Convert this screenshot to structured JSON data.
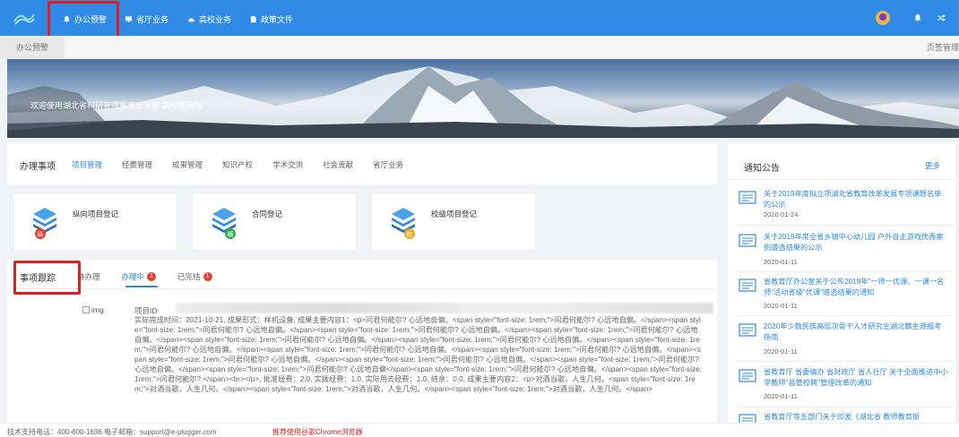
{
  "topbar": {
    "nav": [
      {
        "label": "办公预警",
        "icon": "bell-icon"
      },
      {
        "label": "省厅业务",
        "icon": "monitor-icon"
      },
      {
        "label": "高校业务",
        "icon": "cloud-icon"
      },
      {
        "label": "政策文件",
        "icon": "file-icon"
      }
    ],
    "accent": "#2f8be6",
    "highlight": "#e02020"
  },
  "breadcrumb": {
    "current": "办公预警",
    "right": "页签管理"
  },
  "banner": {
    "text": "欢迎使用湖北省科研管理服务云平台-高校通用版"
  },
  "tasks": {
    "title": "办理事项",
    "tabs": [
      "项目管理",
      "经费管理",
      "成果管理",
      "知识产权",
      "学术交流",
      "社会贡献",
      "省厅业务"
    ],
    "active_tab": "项目管理",
    "cards": [
      {
        "label": "纵向项目登记",
        "badge": "纵",
        "badge_color": "#e8402f"
      },
      {
        "label": "合同登记",
        "badge": "横",
        "badge_color": "#2eaa4a"
      },
      {
        "label": "校级项目登记",
        "badge": "校",
        "badge_color": "#f0a81f"
      }
    ]
  },
  "tracking": {
    "title": "事项跟踪",
    "tabs": [
      {
        "label": "待办理",
        "badge": ""
      },
      {
        "label": "办理中",
        "badge": "1"
      },
      {
        "label": "已完结",
        "badge": "1"
      }
    ],
    "active_tab": "办理中",
    "img_alt": "img",
    "item_id_label": "项目ID:",
    "detail": "实际完成时间：2021-10-21, 成果形式：样机设备, 成果主要内容1：<p>问君何能尔? 心远地自偏。<span style=\"font-size: 1rem;\">问君何能尔? 心远地自偏。</span><span style=\"font-size: 1rem;\">问君何能尔? 心远地自偏。</span><span style=\"font-size: 1rem;\">问君何能尔? 心远地自偏。</span><span style=\"font-size: 1rem;\">问君何能尔? 心远地自偏。</span><span style=\"font-size: 1rem;\">问君何能尔? 心远地自偏。</span><span style=\"font-size: 1rem;\">问君何能尔? 心远地自偏。</span><span style=\"font-size: 1rem;\">问君何能尔? 心远地自偏。</span><span style=\"font-size: 1rem;\">问君何能尔? 心远地自偏。</span><span style=\"font-size: 1rem;\">问君何能尔? 心远地自偏。</span><span style=\"font-size: 1rem;\">问君何能尔? 心远地自偏。</span><span style=\"font-size: 1rem;\">问君何能尔? 心远地自偏。</span><span style=\"font-size: 1rem;\">问君何能尔? 心远地自偏。</span><span style=\"font-size: 1rem;\">问君何能尔? 心远地自偏</span><span style=\"font-size: 1rem;\">问君何能尔? 心远地自偏。</span><span style=\"font-size: 1rem;\">问君何能尔? </span><br></p>, 批准经费：2.0, 实拨经费：1.0, 实际用去经费：1.0, 结余：0.0, 成果主要内容2：<p>对酒当歌，人生几何。<span style=\"font-size: 1rem;\">对酒当歌，人生几何。</span><span style=\"font-size: 1rem;\">对酒当歌，人生几何。</span><span style=\"font-size: 1rem;\">对酒当歌，人生几何。</span>"
  },
  "notices": {
    "title": "通知公告",
    "more": "更多",
    "items": [
      {
        "title": "关于2019年度拟立项湖北省教育改革发展专项课题名单的公示",
        "date": "2020-01-24"
      },
      {
        "title": "关于2019年度全省乡镇中心幼儿园 户外自主游戏优秀案例遴选结果的公示",
        "date": "2020-01-11"
      },
      {
        "title": "省教育厅办公室关于公布2019年\"一师一优课、一课一名师\"活动省级\"优课\"遴选结果的通知",
        "date": "2020-01-11"
      },
      {
        "title": "2020年少数民族高层次骨干人才研究生湖北籍生源报考指南",
        "date": "2020-01-11"
      },
      {
        "title": "省教育厅 省委编办 省财政厅 省人社厅 关于全面推进中小学教师\"县管校聘\"管理改革的通知",
        "date": "2020-01-11"
      },
      {
        "title": "省教育厅等五部门关于印发《湖北省 教师教育振",
        "date": ""
      }
    ]
  },
  "footer": {
    "contact": "技术支持电话：400-800-1636 电子邮箱：support@e-plugger.com",
    "browser_tip": "推荐使用谷歌Chrome浏览器"
  }
}
